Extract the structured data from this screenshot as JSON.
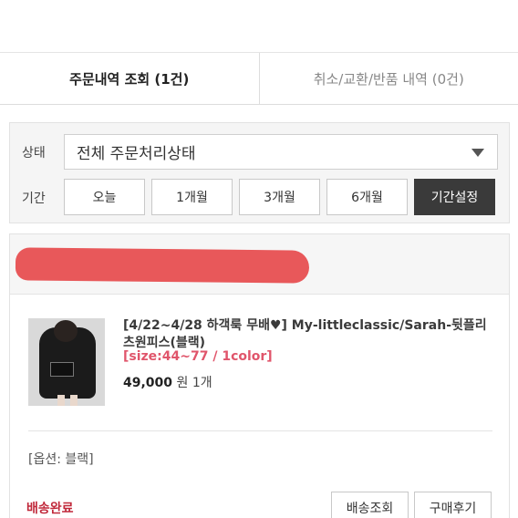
{
  "tabs": [
    {
      "label": "주문내역 조회 (1건)",
      "active": true
    },
    {
      "label": "취소/교환/반품 내역 (0건)",
      "active": false
    }
  ],
  "filter": {
    "status_label": "상태",
    "status_value": "전체 주문처리상태",
    "period_label": "기간",
    "period_options": [
      {
        "label": "오늘",
        "active": false
      },
      {
        "label": "1개월",
        "active": false
      },
      {
        "label": "3개월",
        "active": false
      },
      {
        "label": "6개월",
        "active": false
      },
      {
        "label": "기간설정",
        "active": true
      }
    ]
  },
  "order": {
    "product_name": "[4/22~4/28 하객룩 무배♥] My-littleclassic/Sarah-뒷플리츠원피스(블랙)",
    "size": "[size:44~77 / 1color]",
    "price": "49,000",
    "currency": "원",
    "quantity": "1개",
    "option": "[옵션: 블랙]",
    "delivery_status": "배송완료",
    "buttons": {
      "track": "배송조회",
      "review": "구매후기"
    }
  },
  "colors": {
    "accent_red": "#c0283a",
    "size_pink": "#e0556b",
    "redaction": "#e8585a",
    "active_button": "#3a3a3a"
  }
}
